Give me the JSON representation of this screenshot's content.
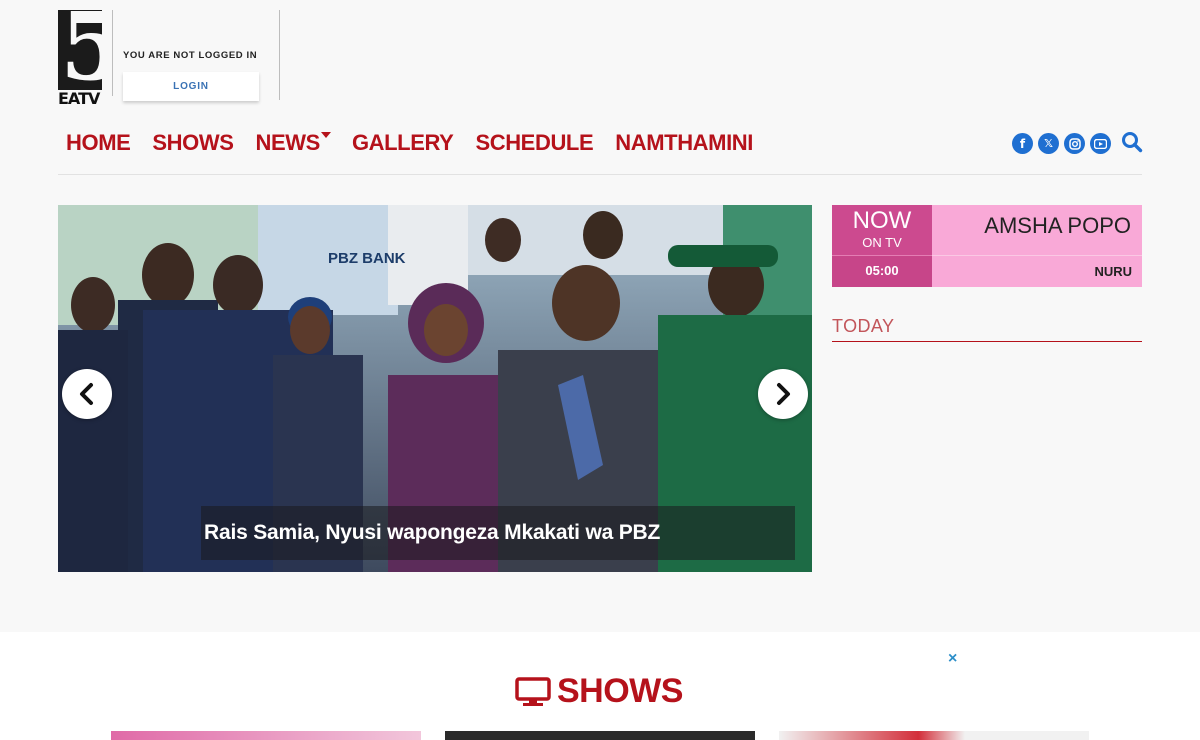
{
  "logo": {
    "number": "5",
    "text": "EATV"
  },
  "account": {
    "status": "YOU ARE NOT LOGGED IN",
    "login_label": "LOGIN"
  },
  "nav": {
    "items": [
      "HOME",
      "SHOWS",
      "NEWS",
      "GALLERY",
      "SCHEDULE",
      "NAMTHAMINI"
    ]
  },
  "social": {
    "icons": [
      "facebook-icon",
      "x-icon",
      "instagram-icon",
      "youtube-icon",
      "search-icon"
    ]
  },
  "slider": {
    "caption": "Rais Samia, Nyusi wapongeza Mkakati wa PBZ",
    "background_text": "PBZ BANK"
  },
  "now_on_tv": {
    "now": "NOW",
    "on_tv": "ON TV",
    "show": "AMSHA POPO",
    "time": "05:00",
    "host": "NURU"
  },
  "today": {
    "label": "TODAY"
  },
  "shows_section": {
    "title": "SHOWS",
    "close": "×"
  },
  "colors": {
    "brand_red": "#b5121b",
    "now_pink": "#cc4a8f",
    "show_pink": "#f9a9d7",
    "social_blue": "#1f6fd1"
  }
}
